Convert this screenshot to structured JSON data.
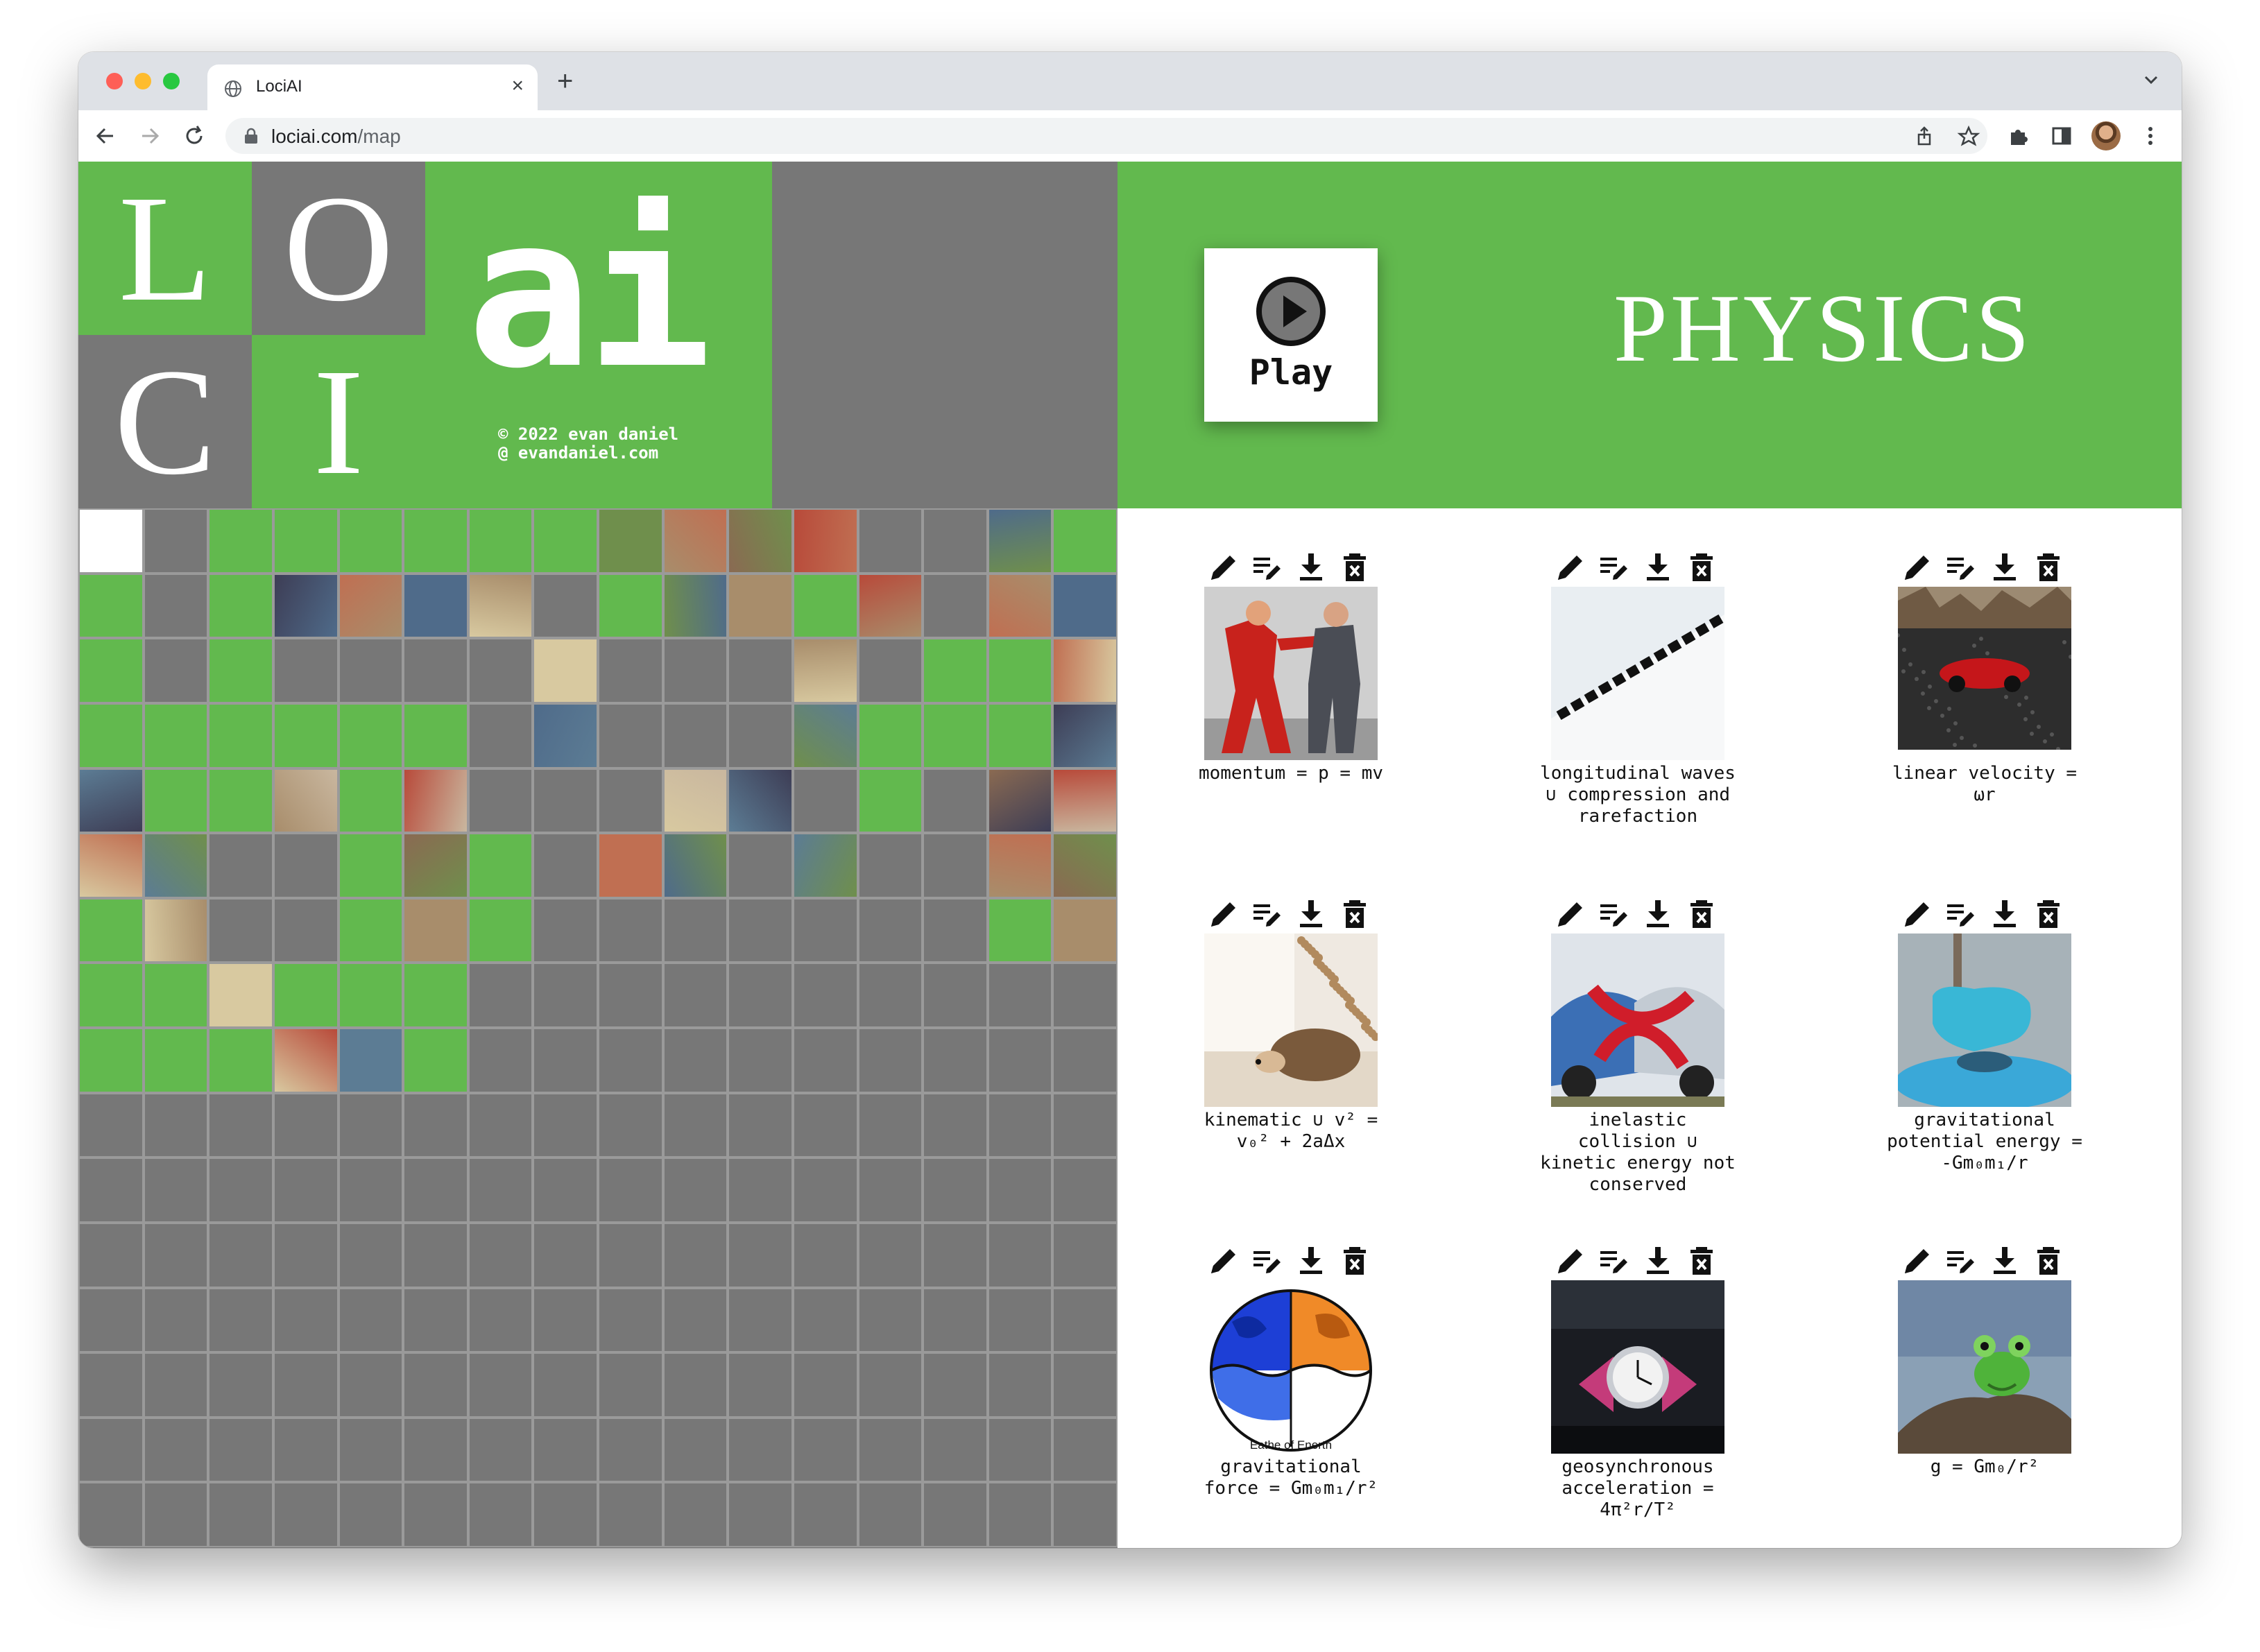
{
  "browser": {
    "tab_title": "LociAI",
    "tab_close": "×",
    "new_tab": "+",
    "url_host": "lociai.com",
    "url_path": "/map"
  },
  "logo": {
    "letters": [
      "L",
      "O",
      "C",
      "I"
    ],
    "ai": "ai",
    "copyright": "© 2022 evan daniel",
    "site": "@ evandaniel.com"
  },
  "colors": {
    "green": "#62b94e",
    "gray": "#777777",
    "white": "#ffffff"
  },
  "map_grid": {
    "rows": [
      "WGLLLLLLIIIIGGIL",
      "LGLIIIIGLIILIGII",
      "LGLGGGGIGGGIGLLI",
      "LLLLLLGIGGGILLLI",
      "ILLILIGGGIIGLGII",
      "IIGGLILGIIGIGGII",
      "LIGGLILGGGGGGGLI",
      "LLILLLGGGGGGGGGG",
      "LLLIILGGGGGGGGGG",
      "GGGGGGGGGGGGGGGG",
      "GGGGGGGGGGGGGGGG",
      "GGGGGGGGGGGGGGGG",
      "GGGGGGGGGGGGGGGG",
      "GGGGGGGGGGGGGGGG",
      "GGGGGGGGGGGGGGGG",
      "GGGGGGGGGGGGGGGG"
    ]
  },
  "header": {
    "play_label": "Play",
    "play_icon": "play-circle-icon",
    "title": "PHYSICS"
  },
  "action_icons": [
    "pencil-icon",
    "edit-list-icon",
    "download-icon",
    "delete-icon"
  ],
  "cards": [
    {
      "caption": "momentum = p = mv",
      "image": "red-suit-push"
    },
    {
      "caption": "longitudinal waves ∪ compression and rarefaction",
      "image": "rubber-strip"
    },
    {
      "caption": "linear velocity = ωr",
      "image": "toy-car-road"
    },
    {
      "caption": "kinematic ∪ v² = v₀² + 2aΔx",
      "image": "hedgehog"
    },
    {
      "caption": "inelastic collision ∪ kinetic energy not conserved",
      "image": "cars-red-ribbon"
    },
    {
      "caption": "gravitational potential energy = -Gm₀m₁/r",
      "image": "blue-clay-pin"
    },
    {
      "caption": "gravitational force = Gm₀m₁/r²",
      "image": "earth-diagram",
      "image_text": "Eathe of Enerth"
    },
    {
      "caption": "geosynchronous acceleration = 4π²r/T²",
      "image": "pink-watch"
    },
    {
      "caption": "g = Gm₀/r²",
      "image": "frog-rock"
    }
  ]
}
